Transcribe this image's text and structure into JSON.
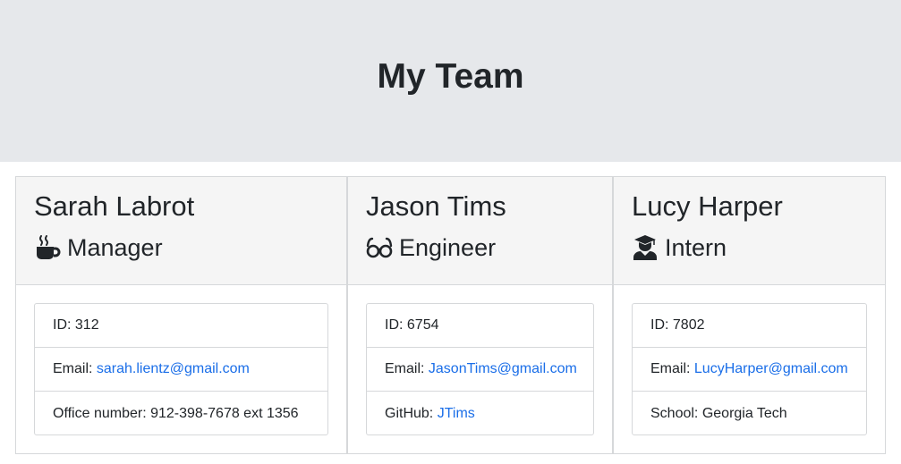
{
  "header": {
    "title": "My Team"
  },
  "team": [
    {
      "name": "Sarah Labrot",
      "role": "Manager",
      "role_icon": "coffee-mug-icon",
      "id_label": "ID:",
      "id": "312",
      "email_label": "Email:",
      "email": "sarah.lientz@gmail.com",
      "extra_label": "Office number:",
      "extra": "912-398-7678 ext 1356"
    },
    {
      "name": "Jason Tims",
      "role": "Engineer",
      "role_icon": "glasses-icon",
      "id_label": "ID:",
      "id": "6754",
      "email_label": "Email:",
      "email": "JasonTims@gmail.com",
      "extra_label": "GitHub:",
      "extra": "JTims"
    },
    {
      "name": "Lucy Harper",
      "role": "Intern",
      "role_icon": "graduate-icon",
      "id_label": "ID:",
      "id": "7802",
      "email_label": "Email:",
      "email": "LucyHarper@gmail.com",
      "extra_label": "School:",
      "extra": "Georgia Tech"
    }
  ],
  "colors": {
    "header_bg": "#e6e8eb",
    "card_header_bg": "#f5f5f5",
    "link": "#1a6ee8",
    "text": "#212529"
  }
}
